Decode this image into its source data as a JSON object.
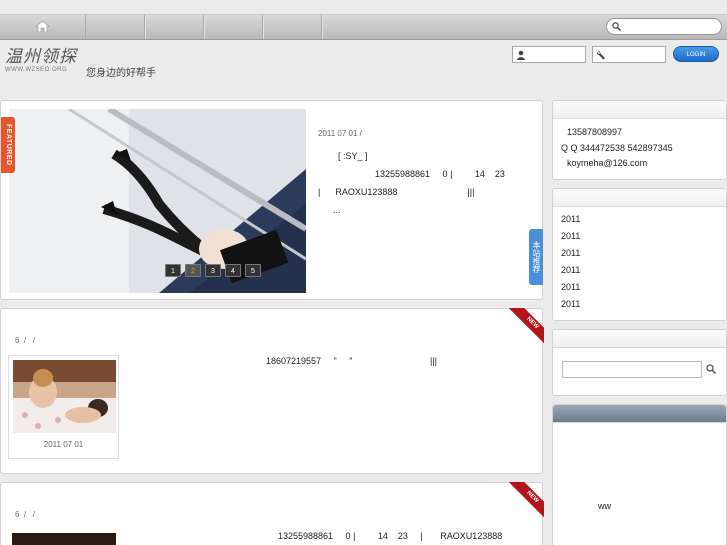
{
  "logo": {
    "name_cn": "温州领探",
    "url": "WWW.WZSEO.ORG"
  },
  "slogan": "您身边的好帮手",
  "topbar": {
    "search_placeholder": ""
  },
  "login": {
    "username_placeholder": "",
    "password_placeholder": "",
    "button_label": "LOGIN"
  },
  "featured": {
    "ribbon_label": "FEATURED",
    "pages": [
      "1",
      "2",
      "3",
      "4",
      "5"
    ],
    "active_page": 2,
    "date": "2011 07 01 /",
    "lines": [
      "[ :SY_ ]",
      "13255988861     0 |         14    23",
      "|      RAOXU123888                            |||",
      "..."
    ],
    "side_tab": "本站推荐"
  },
  "posts": [
    {
      "badge": "NEW",
      "crumbs": "6  /   /",
      "date": "2011 07 01",
      "text": "18607219557     \"     \"                               |||"
    },
    {
      "badge": "NEW",
      "crumbs": "6  /   /",
      "text": "13255988861     0 |         14    23     |       RAOXU123888"
    }
  ],
  "sidebar": {
    "contact": {
      "phone": "13587808997",
      "qq": "Q Q 344472538 542897345",
      "email": "koymeha@126.com"
    },
    "archives": [
      "2011",
      "2011",
      "2011",
      "2011",
      "2011",
      "2011"
    ],
    "search_placeholder": "",
    "widget4_text": "ww"
  }
}
